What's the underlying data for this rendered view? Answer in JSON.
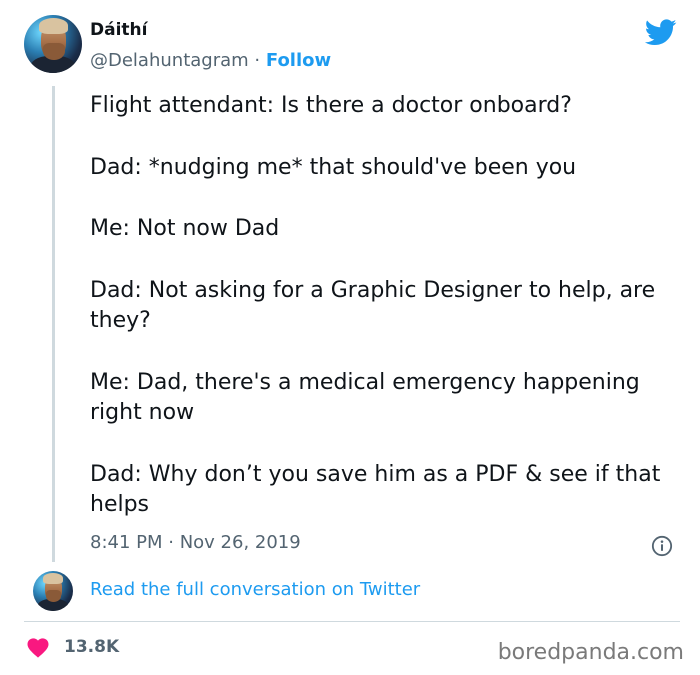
{
  "tweet": {
    "author_name": "Dáithí",
    "handle": "@Delahuntagram",
    "separator": "·",
    "follow_label": "Follow",
    "lines": [
      "Flight attendant: Is there a doctor onboard?",
      "Dad: *nudging me* that should've been you",
      "Me: Not now Dad",
      "Dad: Not asking for a Graphic Designer to help, are they?",
      "Me: Dad, there's a medical emergency happening right now",
      "Dad: Why don’t you save him as a PDF & see if that helps"
    ],
    "timestamp": "8:41 PM · Nov 26, 2019",
    "read_more_label": "Read the full conversation on Twitter",
    "likes": "13.8K"
  },
  "watermark": "boredpanda.com",
  "colors": {
    "twitter_blue": "#1d9bf0",
    "heart_pink": "#f91880",
    "text_primary": "#0f1419",
    "text_secondary": "#536471"
  },
  "icons": [
    "twitter-bird-icon",
    "info-icon",
    "heart-icon"
  ]
}
